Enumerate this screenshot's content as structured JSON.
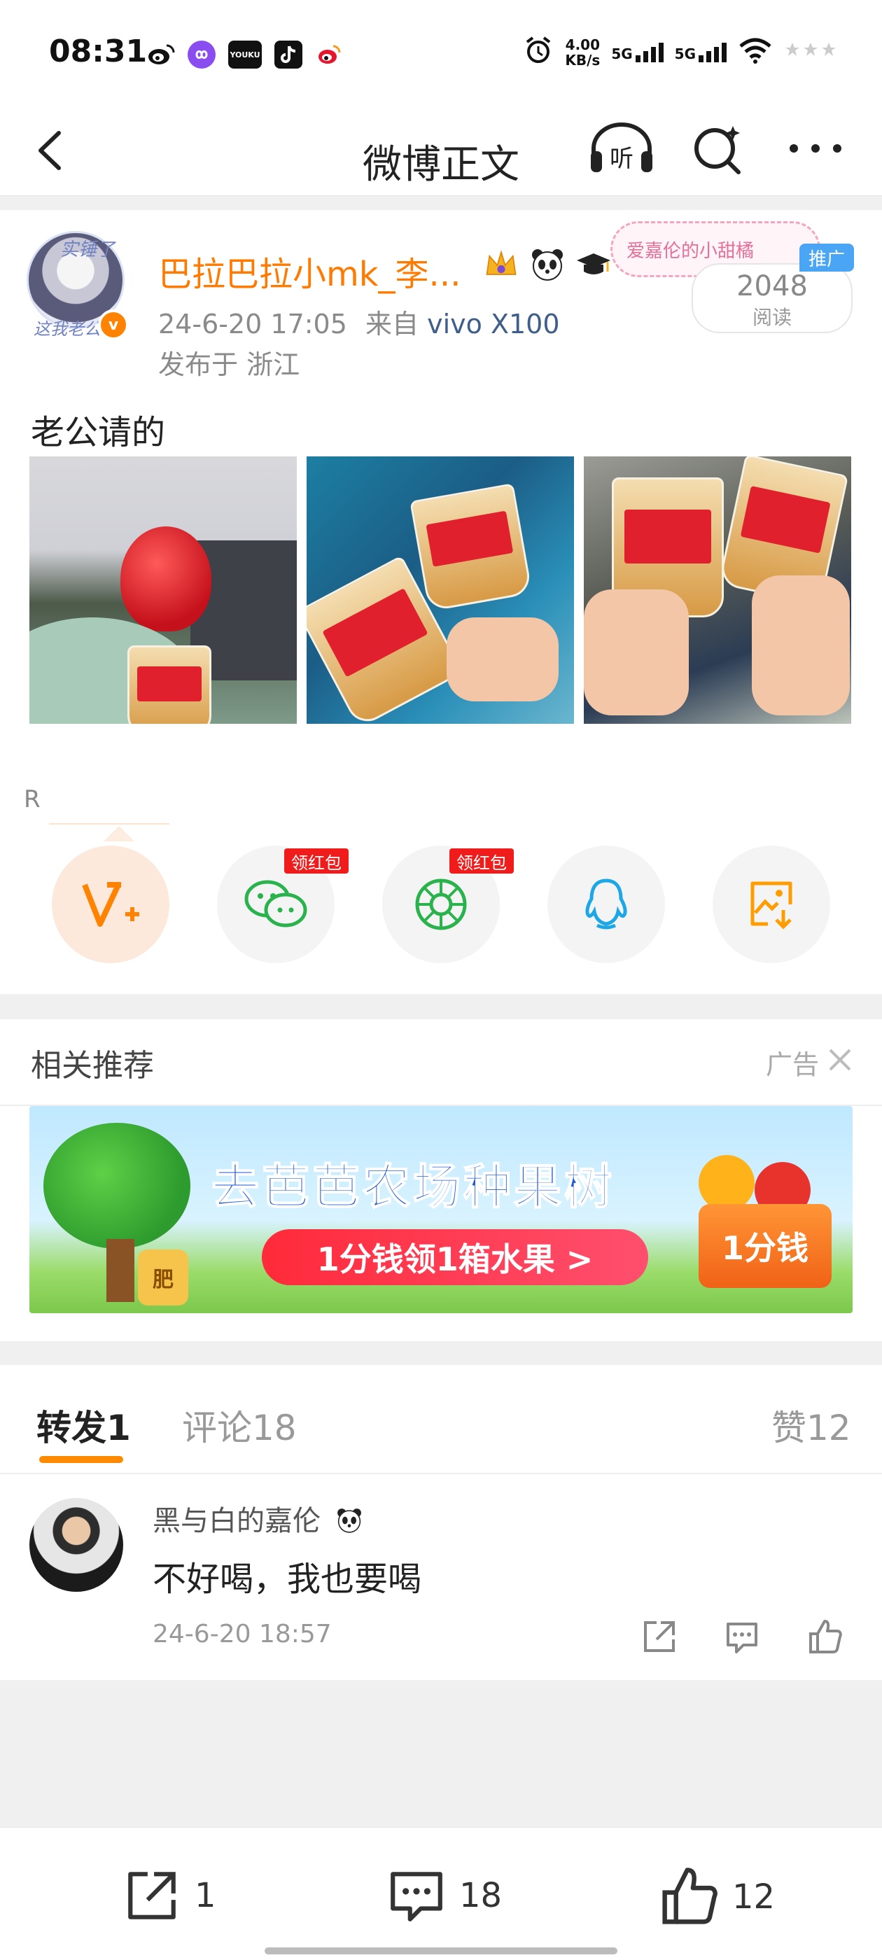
{
  "status_bar": {
    "time": "08:31",
    "net_speed_value": "4.00",
    "net_speed_unit": "KB/s",
    "signal1": "5G",
    "signal2": "5G",
    "app_icons": [
      "weibo-icon",
      "infinity-icon",
      "youku-icon",
      "tiktok-icon",
      "weibo-icon"
    ],
    "youku_text": "YOUKU"
  },
  "nav": {
    "title": "微博正文",
    "listen_label": "听"
  },
  "post": {
    "username": "巴拉巴拉小mk_李...",
    "avatar_frame_top": "实锤了",
    "avatar_frame_bottom": "这我老公",
    "fan_card_text": "爱嘉伦的小甜橘",
    "promo_tag": "推广",
    "read_count": "2048",
    "read_label": "阅读",
    "date": "24-6-20 17:05",
    "source_prefix": "来自",
    "device": "vivo X100",
    "location": "发布于 浙江",
    "text": "老公请的",
    "r_label": "R",
    "share_targets": [
      {
        "name": "vplus",
        "badge": ""
      },
      {
        "name": "wechat",
        "badge": "领红包"
      },
      {
        "name": "moments",
        "badge": "领红包"
      },
      {
        "name": "qq",
        "badge": ""
      },
      {
        "name": "save-image",
        "badge": ""
      }
    ]
  },
  "related": {
    "title": "相关推荐",
    "ad_label": "广告",
    "banner": {
      "headline": "去芭芭农场种果树",
      "pill": "1分钱领1箱水果 >",
      "box": "1分钱",
      "bag": "肥"
    }
  },
  "comments_section": {
    "tabs": [
      {
        "label": "转发",
        "count": "1"
      },
      {
        "label": "评论",
        "count": "18"
      },
      {
        "label": "赞",
        "count": "12"
      }
    ],
    "items": [
      {
        "name": "黑与白的嘉伦",
        "text": "不好喝，我也要喝",
        "time": "24-6-20 18:57"
      }
    ]
  },
  "bottom_bar": {
    "repost_count": "1",
    "comment_count": "18",
    "like_count": "12"
  },
  "colors": {
    "accent": "#ff8200",
    "username": "#ff7a00",
    "device_link": "#3f5f8a",
    "redpack": "#f01c1c",
    "ad_blue": "#1e59d8"
  }
}
